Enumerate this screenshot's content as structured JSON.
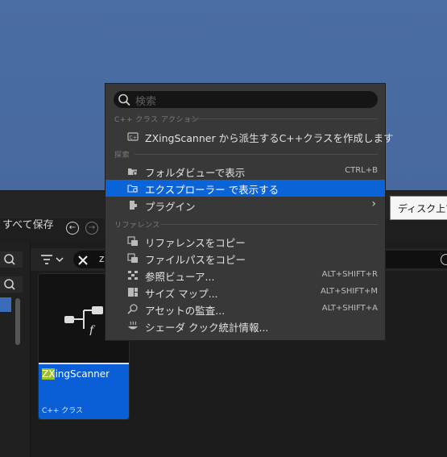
{
  "background": {
    "toolbar": {
      "save_all_label": "すべて保存"
    }
  },
  "tooltip": {
    "text": "ディスク上で"
  },
  "asset": {
    "name_highlight": "ZX",
    "name_rest": "ingScanner",
    "type_label": "C++ クラス"
  },
  "menu": {
    "search_placeholder": "検索",
    "sections": [
      {
        "header": "C++ クラス アクション",
        "items": [
          {
            "label": "ZXingScanner から派生するC++クラスを作成します",
            "shortcut": "",
            "icon": "cpp-class-icon"
          }
        ]
      },
      {
        "header": "探索",
        "items": [
          {
            "label": "フォルダビューで表示",
            "shortcut": "CTRL+B",
            "icon": "folder-search-icon"
          },
          {
            "label": "エクスプローラー で表示する",
            "shortcut": "",
            "icon": "explorer-folder-icon",
            "selected": true
          },
          {
            "label": "プラグイン",
            "shortcut": "",
            "icon": "plugin-icon",
            "submenu": true
          }
        ]
      },
      {
        "header": "リファレンス",
        "items": [
          {
            "label": "リファレンスをコピー",
            "shortcut": "",
            "icon": "copy-reference-icon"
          },
          {
            "label": "ファイルパスをコピー",
            "shortcut": "",
            "icon": "copy-filepath-icon"
          },
          {
            "label": "参照ビューア...",
            "shortcut": "ALT+SHIFT+R",
            "icon": "reference-viewer-icon"
          },
          {
            "label": "サイズ マップ...",
            "shortcut": "ALT+SHIFT+M",
            "icon": "size-map-icon"
          },
          {
            "label": "アセットの監査...",
            "shortcut": "ALT+SHIFT+A",
            "icon": "asset-audit-icon"
          },
          {
            "label": "シェーダ クック統計情報...",
            "shortcut": "",
            "icon": "shader-stats-icon"
          }
        ]
      }
    ]
  },
  "colors": {
    "accent": "#0b63d8",
    "highlight": "#9bbf2c",
    "menu_bg": "#383838"
  }
}
